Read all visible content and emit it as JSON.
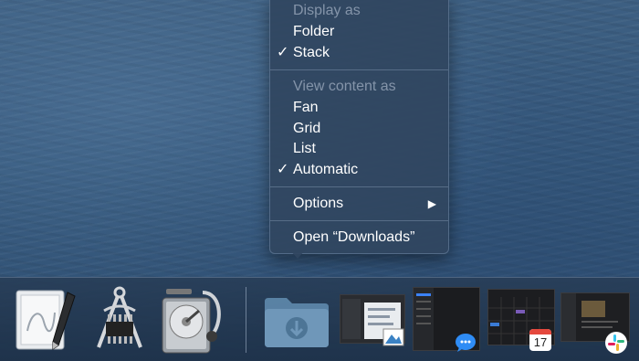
{
  "context_menu": {
    "display_as_header": "Display as",
    "folder_label": "Folder",
    "stack_label": "Stack",
    "stack_checked": true,
    "view_content_header": "View content as",
    "fan_label": "Fan",
    "grid_label": "Grid",
    "list_label": "List",
    "automatic_label": "Automatic",
    "automatic_checked": true,
    "options_label": "Options",
    "open_label": "Open “Downloads”",
    "checkmark": "✓",
    "submenu_arrow": "▶"
  },
  "dock": {
    "items": [
      {
        "name": "script-editor-icon"
      },
      {
        "name": "system-information-icon"
      },
      {
        "name": "disk-utility-icon"
      },
      {
        "name": "downloads-folder-icon"
      },
      {
        "name": "preview-window-thumbnail"
      },
      {
        "name": "messages-window-thumbnail"
      },
      {
        "name": "calendar-window-thumbnail"
      },
      {
        "name": "slack-window-thumbnail"
      }
    ],
    "calendar_badge": "17"
  }
}
